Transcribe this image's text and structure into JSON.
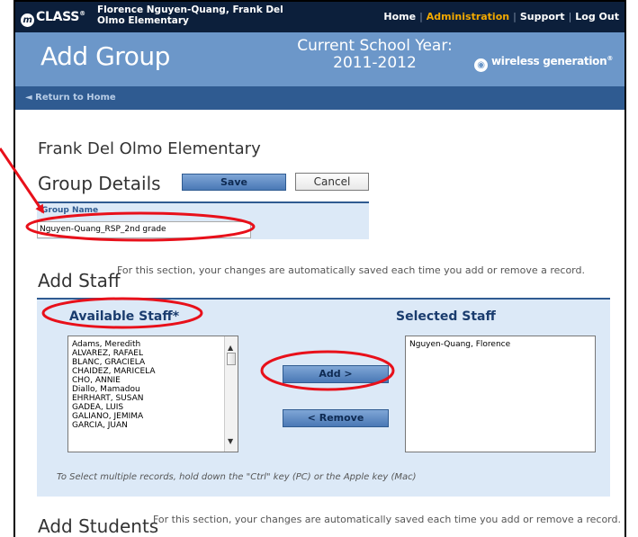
{
  "topbar": {
    "logo_glyph": "m",
    "logo_text": "CLASS",
    "logo_mark": "®",
    "school": "Florence Nguyen-Quang, Frank Del Olmo Elementary",
    "nav": [
      {
        "label": "Home",
        "active": false
      },
      {
        "label": "Administration",
        "active": true
      },
      {
        "label": "Support",
        "active": false
      },
      {
        "label": "Log Out",
        "active": false
      }
    ]
  },
  "header": {
    "title": "Add Group",
    "school_year": "Current School Year: 2011-2012",
    "brand": "wireless generation",
    "brand_mark": "®"
  },
  "returnbar": {
    "link": "◄ Return to Home"
  },
  "main": {
    "school_name": "Frank Del Olmo Elementary",
    "section_title": "Group Details",
    "save_label": "Save",
    "cancel_label": "Cancel",
    "group_name_label": "Group Name",
    "group_name_value": "Nguyen-Quang_RSP_2nd grade"
  },
  "staff": {
    "title": "Add Staff",
    "note": "For this section, your changes are automatically saved each time you add or remove a record.",
    "available_label": "Available Staff*",
    "selected_label": "Selected Staff",
    "available": [
      "Adams, Meredith",
      "ALVAREZ, RAFAEL",
      "BLANC, GRACIELA",
      "CHAIDEZ, MARICELA",
      "CHO, ANNIE",
      "Diallo, Mamadou",
      "EHRHART, SUSAN",
      "GADEA, LUIS",
      "GALIANO, JEMIMA",
      "GARCIA, JUAN"
    ],
    "selected": [
      "Nguyen-Quang, Florence"
    ],
    "add_label": "Add >",
    "remove_label": "< Remove",
    "multi_select_note": "To Select multiple records, hold down the \"Ctrl\" key (PC) or the Apple key (Mac)"
  },
  "students": {
    "title": "Add Students",
    "note": "For this section, your changes are automatically saved each time you add or remove a record."
  },
  "colors": {
    "topbar": "#0c1f3b",
    "header": "#6c97c9",
    "returnbar": "#2f5b91",
    "panel": "#dce9f7",
    "active_nav": "#f2a900",
    "annotation": "#e8101a"
  }
}
